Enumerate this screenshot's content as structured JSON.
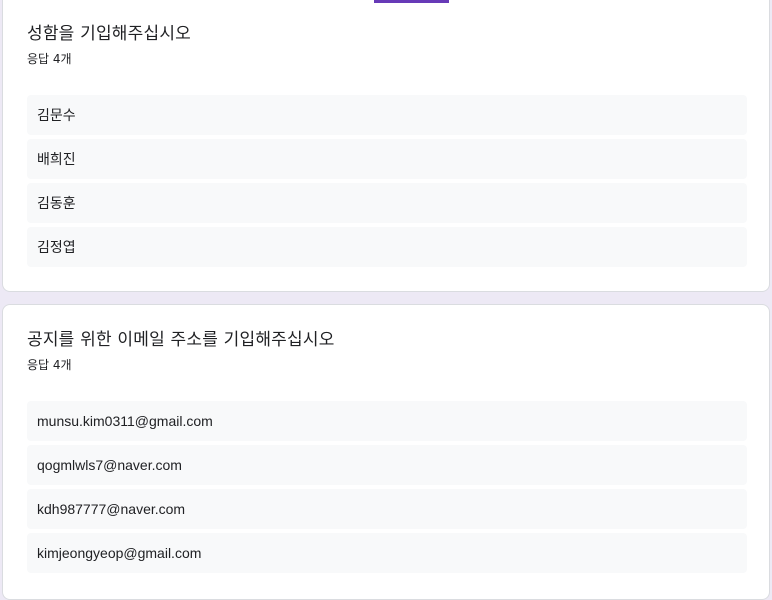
{
  "theme": {
    "accent": "#673ab7",
    "background": "#ede9f5",
    "row_bg": "#f8f9fa"
  },
  "questions": [
    {
      "title": "성함을 기입해주십시오",
      "response_count": "응답 4개",
      "responses": [
        "김문수",
        "배희진",
        "김동훈",
        "김정엽"
      ]
    },
    {
      "title": "공지를 위한 이메일 주소를 기입해주십시오",
      "response_count": "응답 4개",
      "responses": [
        "munsu.kim0311@gmail.com",
        "qogmlwls7@naver.com",
        "kdh987777@naver.com",
        "kimjeongyeop@gmail.com"
      ]
    }
  ]
}
